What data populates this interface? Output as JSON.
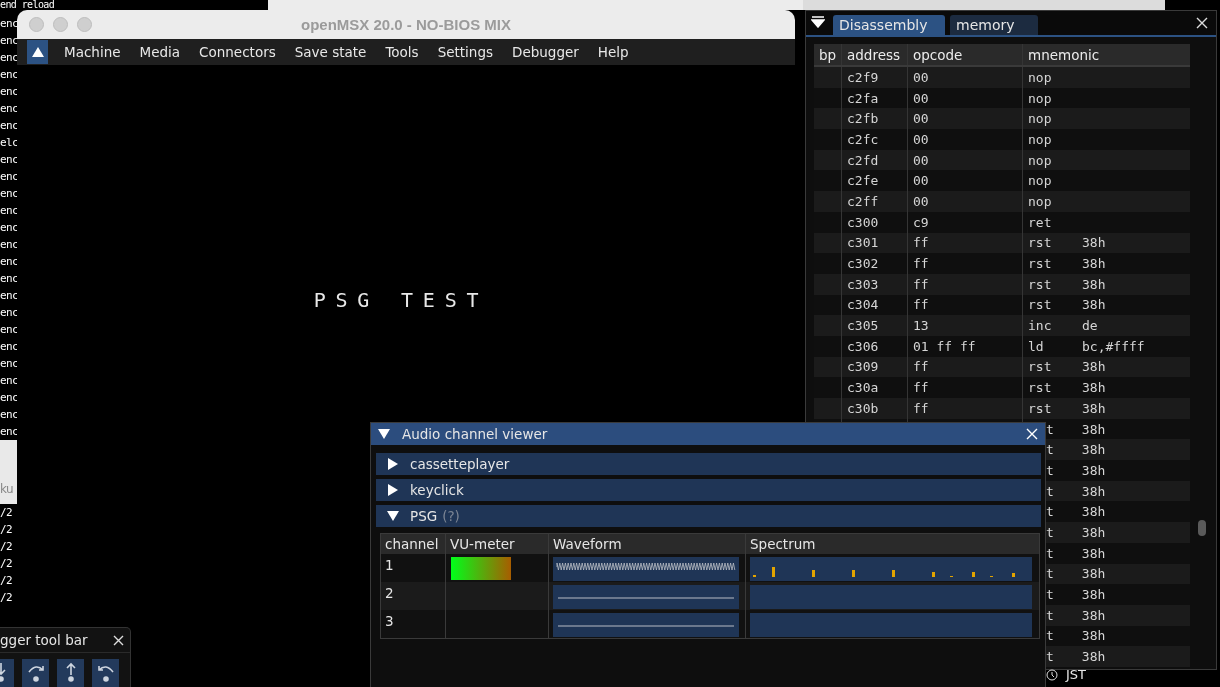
{
  "terminal": {
    "lines": [
      "end reload",
      "enc",
      "enc",
      "enc",
      "enc",
      "enc",
      "enc",
      "enc",
      "elc",
      "enc",
      "enc",
      "enc",
      "enc",
      "enc",
      "enc",
      "enc",
      "enc",
      "enc",
      "enc",
      "enc",
      "enc",
      "enc",
      "enc",
      "enc",
      "enc",
      "enc"
    ],
    "popup_text": "ku",
    "lower_lines": [
      "/2",
      "/2",
      "/2",
      "/2",
      "/2",
      "/2"
    ]
  },
  "emulator_window": {
    "title": "openMSX 20.0 - NO-BIOS MIX",
    "menu": [
      "Machine",
      "Media",
      "Connectors",
      "Save state",
      "Tools",
      "Settings",
      "Debugger",
      "Help"
    ],
    "screen_text": "PSG TEST"
  },
  "debugger_toolbar": {
    "title": "gger tool bar",
    "buttons": [
      {
        "kind": "step-in"
      },
      {
        "kind": "step-over"
      },
      {
        "kind": "step-out"
      },
      {
        "kind": "step-back"
      }
    ]
  },
  "disassembly": {
    "tabs": [
      {
        "label": "Disassembly",
        "selected": true
      },
      {
        "label": "memory",
        "selected": false
      }
    ],
    "columns": [
      "bp",
      "address",
      "opcode",
      "mnemonic"
    ],
    "rows": [
      {
        "address": "c2f9",
        "opcode": "00",
        "mnemonic": "nop"
      },
      {
        "address": "c2fa",
        "opcode": "00",
        "mnemonic": "nop"
      },
      {
        "address": "c2fb",
        "opcode": "00",
        "mnemonic": "nop"
      },
      {
        "address": "c2fc",
        "opcode": "00",
        "mnemonic": "nop"
      },
      {
        "address": "c2fd",
        "opcode": "00",
        "mnemonic": "nop"
      },
      {
        "address": "c2fe",
        "opcode": "00",
        "mnemonic": "nop"
      },
      {
        "address": "c2ff",
        "opcode": "00",
        "mnemonic": "nop"
      },
      {
        "address": "c300",
        "opcode": "c9",
        "mnemonic": "ret"
      },
      {
        "address": "c301",
        "opcode": "ff",
        "mnemonic": "rst",
        "operand": "38h"
      },
      {
        "address": "c302",
        "opcode": "ff",
        "mnemonic": "rst",
        "operand": "38h"
      },
      {
        "address": "c303",
        "opcode": "ff",
        "mnemonic": "rst",
        "operand": "38h"
      },
      {
        "address": "c304",
        "opcode": "ff",
        "mnemonic": "rst",
        "operand": "38h"
      },
      {
        "address": "c305",
        "opcode": "13",
        "mnemonic": "inc",
        "operand": "de"
      },
      {
        "address": "c306",
        "opcode": "01 ff ff",
        "mnemonic": "ld",
        "operand": "bc,#ffff"
      },
      {
        "address": "c309",
        "opcode": "ff",
        "mnemonic": "rst",
        "operand": "38h"
      },
      {
        "address": "c30a",
        "opcode": "ff",
        "mnemonic": "rst",
        "operand": "38h"
      },
      {
        "address": "c30b",
        "opcode": "ff",
        "mnemonic": "rst",
        "operand": "38h"
      },
      {
        "mnemonic": "t",
        "operand": "38h"
      },
      {
        "mnemonic": "t",
        "operand": "38h"
      },
      {
        "mnemonic": "t",
        "operand": "38h"
      },
      {
        "mnemonic": "t",
        "operand": "38h"
      },
      {
        "mnemonic": "t",
        "operand": "38h"
      },
      {
        "mnemonic": "t",
        "operand": "38h"
      },
      {
        "mnemonic": "t",
        "operand": "38h"
      },
      {
        "mnemonic": "t",
        "operand": "38h"
      },
      {
        "mnemonic": "t",
        "operand": "38h"
      },
      {
        "mnemonic": "t",
        "operand": "38h"
      },
      {
        "mnemonic": "t",
        "operand": "38h"
      },
      {
        "mnemonic": "t",
        "operand": "38h"
      }
    ]
  },
  "audio_viewer": {
    "title": "Audio channel viewer",
    "sections": [
      {
        "label": "cassetteplayer",
        "expanded": false
      },
      {
        "label": "keyclick",
        "expanded": false
      },
      {
        "label": "PSG",
        "hint": "(?)",
        "expanded": true
      }
    ],
    "columns": [
      "channel",
      "VU-meter",
      "Waveform",
      "Spectrum"
    ],
    "channels": [
      {
        "number": "1",
        "level": 0.62,
        "active": true
      },
      {
        "number": "2",
        "active": false
      },
      {
        "number": "3",
        "active": false
      }
    ]
  },
  "status": {
    "timezone": "JST"
  }
}
